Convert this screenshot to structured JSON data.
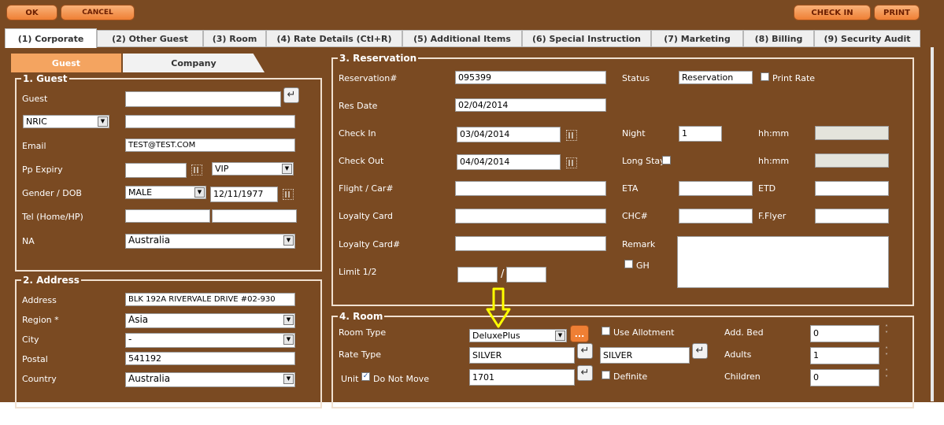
{
  "toolbar": {
    "ok": "OK",
    "cancel": "CANCEL",
    "check_in": "CHECK IN",
    "print": "PRINT"
  },
  "tabs": [
    "(1) Corporate",
    "(2) Other Guest",
    "(3) Room",
    "(4) Rate Details (Ctl+R)",
    "(5) Additional Items",
    "(6) Special Instruction",
    "(7) Marketing",
    "(8) Billing",
    "(9) Security Audit"
  ],
  "subtabs": {
    "guest": "Guest",
    "company": "Company"
  },
  "guest": {
    "legend": "1. Guest",
    "guest_label": "Guest",
    "guest_value": "",
    "id_type": "NRIC",
    "id_value": "",
    "email_label": "Email",
    "email_value": "TEST@TEST.COM",
    "pp_label": "Pp Expiry",
    "pp_value": "",
    "vip_value": "VIP",
    "gender_label": "Gender / DOB",
    "gender_value": "MALE",
    "dob_value": "12/11/1977",
    "tel_label": "Tel (Home/HP)",
    "tel_home": "",
    "tel_hp": "",
    "na_label": "NA",
    "na_value": "Australia"
  },
  "address": {
    "legend": "2. Address",
    "address_label": "Address",
    "address_value": "BLK 192A RIVERVALE DRIVE #02-930",
    "region_label": "Region *",
    "region_value": "Asia",
    "city_label": "City",
    "city_value": "-",
    "postal_label": "Postal",
    "postal_value": "541192",
    "country_label": "Country",
    "country_value": "Australia"
  },
  "reservation": {
    "legend": "3. Reservation",
    "resno_label": "Reservation#",
    "resno_value": "095399",
    "status_label": "Status",
    "status_value": "Reservation",
    "print_rate_label": "Print Rate",
    "resdate_label": "Res Date",
    "resdate_value": "02/04/2014",
    "checkin_label": "Check In",
    "checkin_value": "03/04/2014",
    "night_label": "Night",
    "night_value": "1",
    "hhmm_label": "hh:mm",
    "checkout_label": "Check Out",
    "checkout_value": "04/04/2014",
    "longstay_label": "Long Stay",
    "flight_label": "Flight / Car#",
    "eta_label": "ETA",
    "etd_label": "ETD",
    "loyalty_label": "Loyalty Card",
    "chc_label": "CHC#",
    "fflyer_label": "F.Flyer",
    "loyaltyno_label": "Loyalty Card#",
    "remark_label": "Remark",
    "gh_label": "GH",
    "limit_label": "Limit 1/2",
    "limit_sep": "/"
  },
  "room": {
    "legend": "4. Room",
    "roomtype_label": "Room Type",
    "roomtype_value": "DeluxePlus",
    "more_label": "...",
    "use_allotment_label": "Use Allotment",
    "addbed_label": "Add. Bed",
    "addbed_value": "0",
    "ratetype_label": "Rate Type",
    "ratetype_value": "SILVER",
    "ratetype_value2": "SILVER",
    "adults_label": "Adults",
    "adults_value": "1",
    "unit_label": "Unit",
    "do_not_move_label": "Do Not Move",
    "unit_value": "1701",
    "definite_label": "Definite",
    "children_label": "Children",
    "children_value": "0"
  },
  "colors": {
    "background": "#7a4a22",
    "button": "#ef7f34",
    "active_subtab": "#f4a460",
    "annotation_arrow": "#ffff00"
  },
  "icons": [
    "return-icon",
    "calendar-icon",
    "dropdown-arrow-icon",
    "checkbox-icon",
    "spinner-icon",
    "down-arrow-annotation-icon"
  ]
}
